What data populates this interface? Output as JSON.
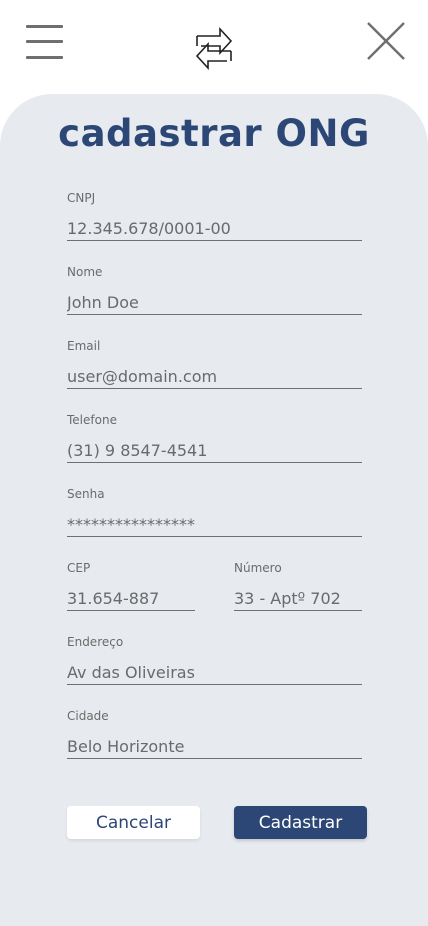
{
  "header": {
    "menu_icon": "hamburger-menu-icon",
    "swap_icon": "swap-arrows-icon",
    "close_icon": "close-icon"
  },
  "page": {
    "title": "cadastrar ONG"
  },
  "form": {
    "cnpj": {
      "label": "CNPJ",
      "value": "12.345.678/0001-00"
    },
    "nome": {
      "label": "Nome",
      "value": "John Doe"
    },
    "email": {
      "label": "Email",
      "value": "user@domain.com"
    },
    "telefone": {
      "label": "Telefone",
      "value": "(31) 9 8547-4541"
    },
    "senha": {
      "label": "Senha",
      "value": "****************"
    },
    "cep": {
      "label": "CEP",
      "value": "31.654-887"
    },
    "numero": {
      "label": "Número",
      "value": "33 - Aptº 702"
    },
    "endereco": {
      "label": "Endereço",
      "value": "Av das Oliveiras"
    },
    "cidade": {
      "label": "Cidade",
      "value": "Belo Horizonte"
    }
  },
  "actions": {
    "cancel_label": "Cancelar",
    "submit_label": "Cadastrar"
  },
  "colors": {
    "primary": "#2c4775",
    "card_background": "#e7eaef",
    "icon_gray": "#6f6f6f"
  }
}
